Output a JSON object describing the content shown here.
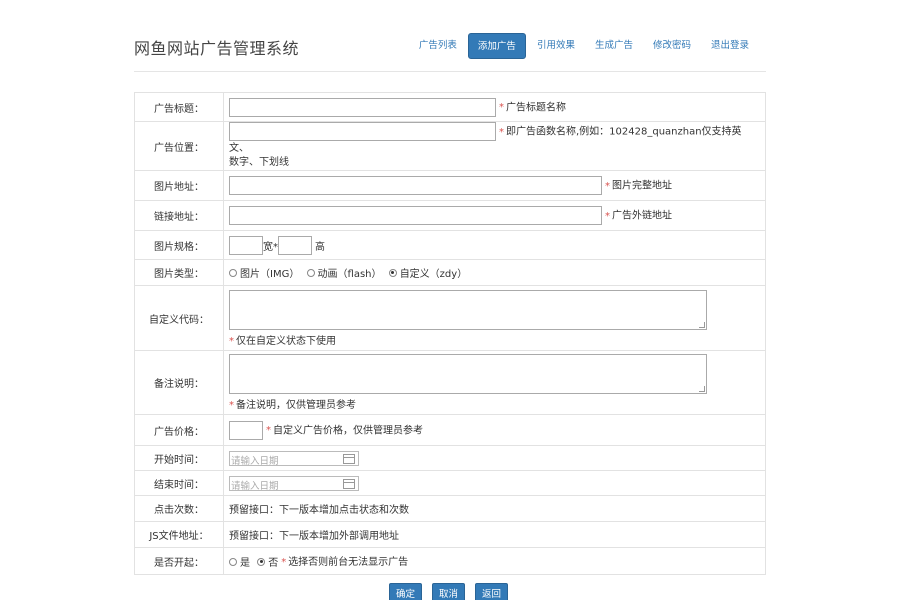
{
  "header": {
    "title": "网鱼网站广告管理系统",
    "nav": [
      {
        "label": "广告列表",
        "active": false
      },
      {
        "label": "添加广告",
        "active": true
      },
      {
        "label": "引用效果",
        "active": false
      },
      {
        "label": "生成广告",
        "active": false
      },
      {
        "label": "修改密码",
        "active": false
      },
      {
        "label": "退出登录",
        "active": false
      }
    ]
  },
  "form": {
    "ad_title": {
      "label": "广告标题：",
      "value": "",
      "req": "*",
      "hint": "广告标题名称"
    },
    "ad_position": {
      "label": "广告位置：",
      "value": "",
      "req": "*",
      "hint_1": "即广告函数名称,例如：102428_quanzhan仅支持英文、",
      "hint_2": "数字、下划线"
    },
    "image_url": {
      "label": "图片地址：",
      "value": "",
      "req": "*",
      "hint": "图片完整地址"
    },
    "link_url": {
      "label": "链接地址：",
      "value": "",
      "req": "*",
      "hint": "广告外链地址"
    },
    "image_size": {
      "label": "图片规格：",
      "width_value": "",
      "width_unit": "宽*",
      "height_value": "",
      "height_unit": "高"
    },
    "image_type": {
      "label": "图片类型：",
      "options": [
        {
          "label": "图片（IMG）",
          "selected": false
        },
        {
          "label": "动画（flash）",
          "selected": false
        },
        {
          "label": "自定义（zdy）",
          "selected": true
        }
      ]
    },
    "custom_code": {
      "label": "自定义代码：",
      "value": "",
      "req": "*",
      "hint": "仅在自定义状态下使用"
    },
    "remarks": {
      "label": "备注说明：",
      "value": "",
      "req": "*",
      "hint": "备注说明，仅供管理员参考"
    },
    "ad_price": {
      "label": "广告价格：",
      "value": "",
      "req": "*",
      "hint": "自定义广告价格，仅供管理员参考"
    },
    "start_time": {
      "label": "开始时间：",
      "placeholder": "请输入日期"
    },
    "end_time": {
      "label": "结束时间：",
      "placeholder": "请输入日期"
    },
    "clicks": {
      "label": "点击次数：",
      "text": "预留接口：下一版本增加点击状态和次数"
    },
    "js_url": {
      "label": "JS文件地址：",
      "text": "预留接口：下一版本增加外部调用地址"
    },
    "enabled": {
      "label": "是否开起：",
      "yes_label": "是",
      "yes_selected": false,
      "no_label": "否",
      "no_selected": true,
      "req": "*",
      "hint": "选择否则前台无法显示广告"
    }
  },
  "buttons": {
    "confirm": "确定",
    "cancel": "取消",
    "back": "返回"
  }
}
